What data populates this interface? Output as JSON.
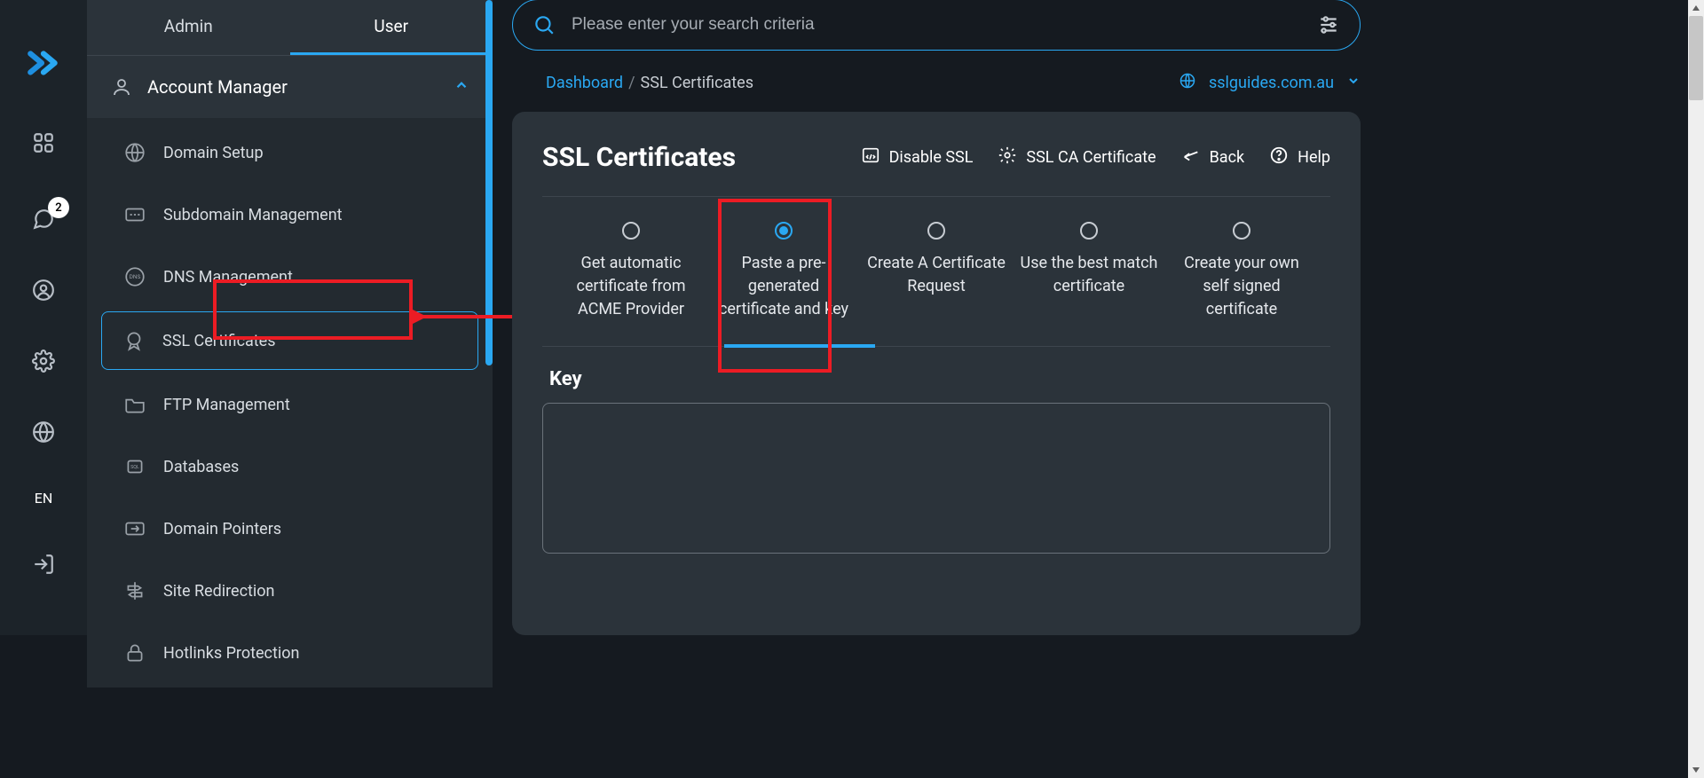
{
  "tabs": {
    "admin": "Admin",
    "user": "User"
  },
  "section": {
    "label": "Account Manager"
  },
  "menu": {
    "items": [
      {
        "label": "Domain Setup"
      },
      {
        "label": "Subdomain Management"
      },
      {
        "label": "DNS Management"
      },
      {
        "label": "SSL Certificates"
      },
      {
        "label": "FTP Management"
      },
      {
        "label": "Databases"
      },
      {
        "label": "Domain Pointers"
      },
      {
        "label": "Site Redirection"
      },
      {
        "label": "Hotlinks Protection"
      }
    ]
  },
  "leftbar": {
    "lang": "EN",
    "notif_count": "2"
  },
  "search": {
    "placeholder": "Please enter your search criteria"
  },
  "breadcrumb": {
    "dashboard": "Dashboard",
    "sep": "/",
    "current": "SSL Certificates"
  },
  "domain": {
    "name": "sslguides.com.au"
  },
  "page": {
    "title": "SSL Certificates",
    "actions": {
      "disable_ssl": "Disable SSL",
      "ca_cert": "SSL CA Certificate",
      "back": "Back",
      "help": "Help"
    }
  },
  "options": [
    "Get automatic certificate from ACME Provider",
    "Paste a pre-generated certificate and key",
    "Create A Certificate Request",
    "Use the best match certificate",
    "Create your own self signed certificate"
  ],
  "field": {
    "key_label": "Key"
  }
}
